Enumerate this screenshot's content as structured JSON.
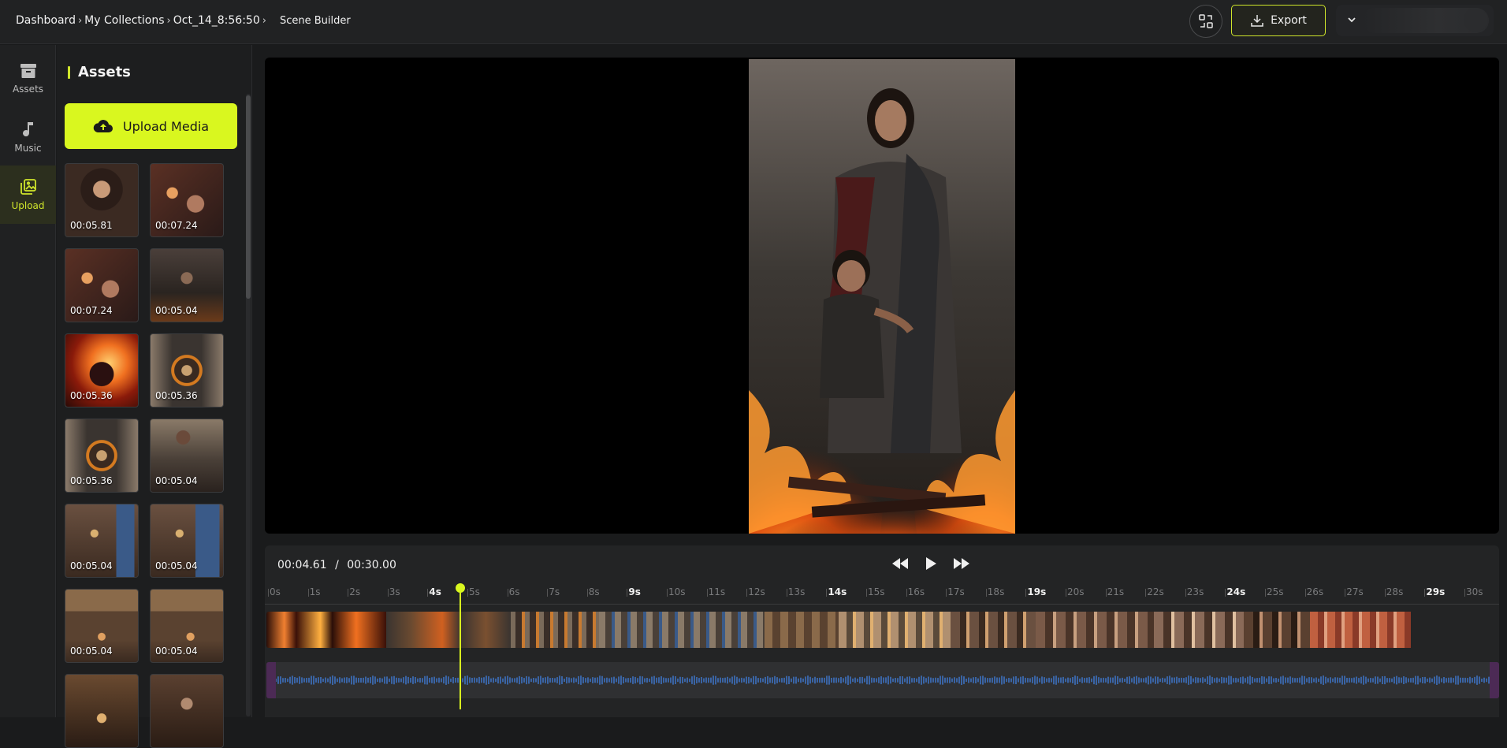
{
  "header": {
    "breadcrumbs": [
      "Dashboard",
      "My Collections",
      "Oct_14_8:56:50"
    ],
    "current_page": "Scene Builder",
    "export_label": "Export"
  },
  "rail": {
    "items": [
      {
        "label": "Assets",
        "icon": "archive-icon",
        "active": false
      },
      {
        "label": "Music",
        "icon": "music-note-icon",
        "active": false
      },
      {
        "label": "Upload",
        "icon": "upload-images-icon",
        "active": true
      }
    ]
  },
  "assets": {
    "title": "Assets",
    "upload_label": "Upload Media",
    "items": [
      {
        "duration": "00:05.81"
      },
      {
        "duration": "00:07.24"
      },
      {
        "duration": "00:07.24"
      },
      {
        "duration": "00:05.04"
      },
      {
        "duration": "00:05.36"
      },
      {
        "duration": "00:05.36"
      },
      {
        "duration": "00:05.36"
      },
      {
        "duration": "00:05.04"
      },
      {
        "duration": "00:05.04"
      },
      {
        "duration": "00:05.04"
      },
      {
        "duration": "00:05.04"
      },
      {
        "duration": "00:05.04"
      },
      {
        "duration": ""
      },
      {
        "duration": ""
      }
    ]
  },
  "timeline": {
    "current_time": "00:04.61",
    "total_time": "00:30.00",
    "separator": "/",
    "playhead_seconds": 4.61,
    "ticks": [
      "0s",
      "1s",
      "2s",
      "3s",
      "4s",
      "5s",
      "6s",
      "7s",
      "8s",
      "9s",
      "10s",
      "11s",
      "12s",
      "13s",
      "14s",
      "15s",
      "16s",
      "17s",
      "18s",
      "19s",
      "20s",
      "21s",
      "22s",
      "23s",
      "24s",
      "25s",
      "26s",
      "27s",
      "28s",
      "29s",
      "30s"
    ],
    "major_ticks": [
      "4s",
      "9s",
      "14s",
      "19s",
      "24s",
      "29s"
    ]
  },
  "colors": {
    "accent": "#d9f71f",
    "audio_wave": "#3f7bd6"
  }
}
